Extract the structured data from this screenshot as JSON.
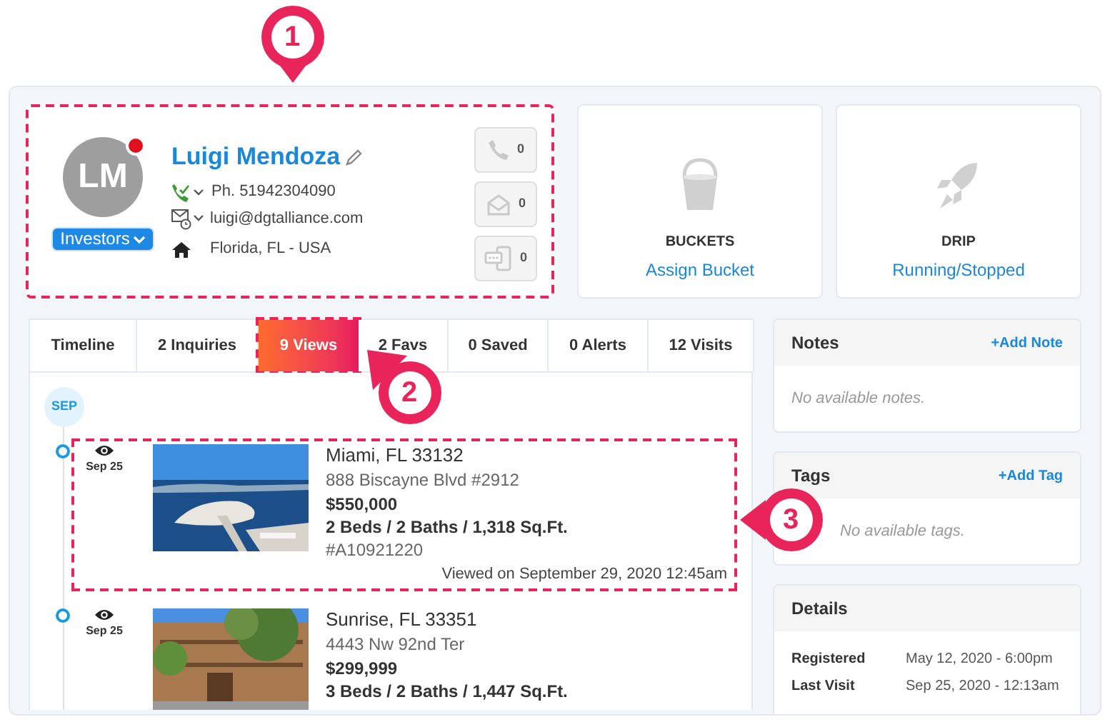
{
  "contact": {
    "initials": "LM",
    "name": "Luigi Mendoza",
    "group": "Investors",
    "phone": "Ph. 51942304090",
    "email": "luigi@dgtalliance.com",
    "location": "Florida, FL - USA",
    "outlined": true,
    "counters": [
      {
        "kind": "call",
        "count": "0"
      },
      {
        "kind": "email",
        "count": "0"
      },
      {
        "kind": "sms",
        "count": "0"
      }
    ]
  },
  "cards": [
    {
      "kind": "bucket",
      "title": "BUCKETS",
      "link": "Assign Bucket"
    },
    {
      "kind": "drip",
      "title": "DRIP",
      "link": "Running/Stopped"
    }
  ],
  "tabs": [
    {
      "label": "Timeline",
      "selected": false,
      "outlined": false
    },
    {
      "label": "2 Inquiries",
      "selected": false,
      "outlined": false
    },
    {
      "label": "9 Views",
      "selected": true,
      "outlined": true
    },
    {
      "label": "2 Favs",
      "selected": false,
      "outlined": false
    },
    {
      "label": "0 Saved",
      "selected": false,
      "outlined": false
    },
    {
      "label": "0 Alerts",
      "selected": false,
      "outlined": false
    },
    {
      "label": "12 Visits",
      "selected": false,
      "outlined": false
    }
  ],
  "timeline": {
    "month": "SEP",
    "items": [
      {
        "date": "Sep 25",
        "city": "Miami, FL 33132",
        "address": "888 Biscayne Blvd #2912",
        "price": "$550,000",
        "specs": "2 Beds / 2 Baths / 1,318 Sq.Ft.",
        "mls": "#A10921220",
        "viewed": "Viewed on September 29, 2020 12:45am",
        "outlined": true
      },
      {
        "date": "Sep 25",
        "city": "Sunrise, FL 33351",
        "address": "4443 Nw 92nd Ter",
        "price": "$299,999",
        "specs": "3 Beds / 2 Baths / 1,447 Sq.Ft.",
        "outlined": false
      }
    ]
  },
  "notes": {
    "title": "Notes",
    "action": "+Add Note",
    "empty": "No available notes."
  },
  "tags": {
    "title": "Tags",
    "action": "+Add Tag",
    "empty": "No available tags."
  },
  "details": {
    "title": "Details",
    "rows": [
      {
        "label": "Registered",
        "value": "May 12, 2020 - 6:00pm"
      },
      {
        "label": "Last Visit",
        "value": "Sep 25, 2020 - 12:13am"
      }
    ]
  },
  "callouts": [
    {
      "label": "1"
    },
    {
      "label": "2"
    },
    {
      "label": "3"
    }
  ]
}
